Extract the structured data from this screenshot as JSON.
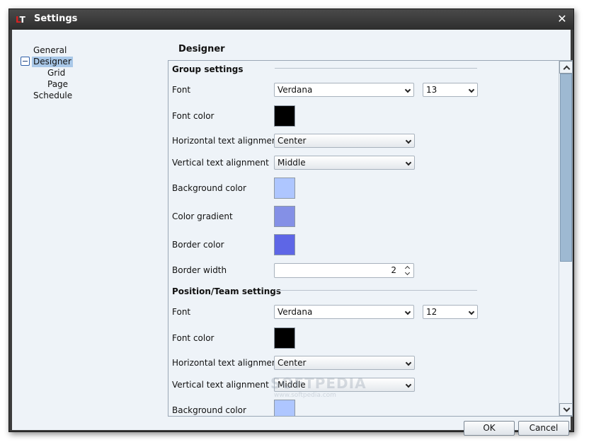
{
  "window": {
    "title": "Settings",
    "logo": {
      "letters": [
        "L",
        "T"
      ]
    },
    "close_glyph": "✕"
  },
  "tree": {
    "items": [
      {
        "label": "General",
        "level": 0
      },
      {
        "label": "Designer",
        "level": 0,
        "selected": true,
        "expanded": true
      },
      {
        "label": "Grid",
        "level": 1
      },
      {
        "label": "Page",
        "level": 1
      },
      {
        "label": "Schedule",
        "level": 0
      }
    ]
  },
  "panel": {
    "title": "Designer"
  },
  "group_settings": {
    "title": "Group settings",
    "font_label": "Font",
    "font_value": "Verdana",
    "font_size": "13",
    "font_color_label": "Font color",
    "font_color": "#000000",
    "halign_label": "Horizontal text alignment",
    "halign_value": "Center",
    "valign_label": "Vertical text alignment",
    "valign_value": "Middle",
    "bg_label": "Background color",
    "bg_color": "#aec6ff",
    "gradient_label": "Color gradient",
    "gradient_color": "#8490e6",
    "border_color_label": "Border color",
    "border_color": "#5e66e6",
    "border_width_label": "Border width",
    "border_width_value": "2"
  },
  "team_settings": {
    "title": "Position/Team settings",
    "font_label": "Font",
    "font_value": "Verdana",
    "font_size": "12",
    "font_color_label": "Font color",
    "font_color": "#000000",
    "halign_label": "Horizontal text alignment",
    "halign_value": "Center",
    "valign_label": "Vertical text alignment",
    "valign_value": "Middle",
    "bg_label": "Background color",
    "bg_color": "#aec6ff"
  },
  "buttons": {
    "ok": "OK",
    "cancel": "Cancel"
  },
  "watermark": {
    "text": "SOFTPEDIA",
    "sub": "www.softpedia.com"
  }
}
